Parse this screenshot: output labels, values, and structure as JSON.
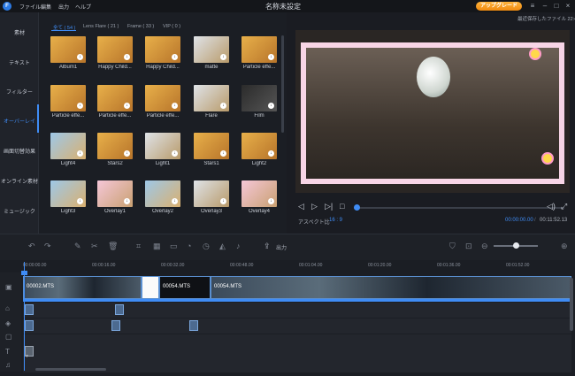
{
  "app": {
    "logo_text": "F",
    "menus": [
      "ファイル",
      "編集",
      "出力",
      "ヘルプ"
    ],
    "title": "名称未設定",
    "upgrade_label": "アップグレード",
    "saved_label": "最近保存したファイル 22:45"
  },
  "sidebar": {
    "items": [
      {
        "label": "素材"
      },
      {
        "label": "テキスト"
      },
      {
        "label": "フィルター"
      },
      {
        "label": "オーバーレイ"
      },
      {
        "label": "画面切替効果"
      },
      {
        "label": "オンライン素材"
      },
      {
        "label": "ミュージック"
      }
    ],
    "active_index": 3
  },
  "media": {
    "tabs": [
      {
        "label": "全て ( 54 )"
      },
      {
        "label": "Lens Flare ( 21 )"
      },
      {
        "label": "Frame ( 33 )"
      },
      {
        "label": "VIP ( 0 )"
      }
    ],
    "items": [
      {
        "label": "Album1"
      },
      {
        "label": "Happy Child..."
      },
      {
        "label": "Happy Child..."
      },
      {
        "label": "matte"
      },
      {
        "label": "Particle effe..."
      },
      {
        "label": "Particle effe..."
      },
      {
        "label": "Particle effe..."
      },
      {
        "label": "Particle effe..."
      },
      {
        "label": "Flare"
      },
      {
        "label": "Film"
      },
      {
        "label": "Light4"
      },
      {
        "label": "Stars2"
      },
      {
        "label": "Light1"
      },
      {
        "label": "Stars1"
      },
      {
        "label": "Light2"
      },
      {
        "label": "Light3"
      },
      {
        "label": "Overlay1"
      },
      {
        "label": "Overlay2"
      },
      {
        "label": "Overlay3"
      },
      {
        "label": "Overlay4"
      }
    ]
  },
  "preview": {
    "aspect_label": "アスペクト比",
    "aspect_value": "16 : 9",
    "current_time": "00:00:00.00",
    "total_time": "00:11:52.13",
    "playback_position": 0.0
  },
  "timeline": {
    "export_label": "出力",
    "ruler_ticks": [
      "00:00:00.00",
      "00:00:16.00",
      "00:00:32.00",
      "00:00:48.00",
      "00:01:04.00",
      "00:01:20.00",
      "00:01:36.00",
      "00:01:52.00"
    ],
    "clips": [
      {
        "label": "00002.MTS"
      },
      {
        "label": "00054.MTS"
      },
      {
        "label": "00054.MTS"
      }
    ],
    "text_marker": "T"
  },
  "colors": {
    "accent": "#3f8cf5",
    "upgrade": "#f5a020"
  }
}
